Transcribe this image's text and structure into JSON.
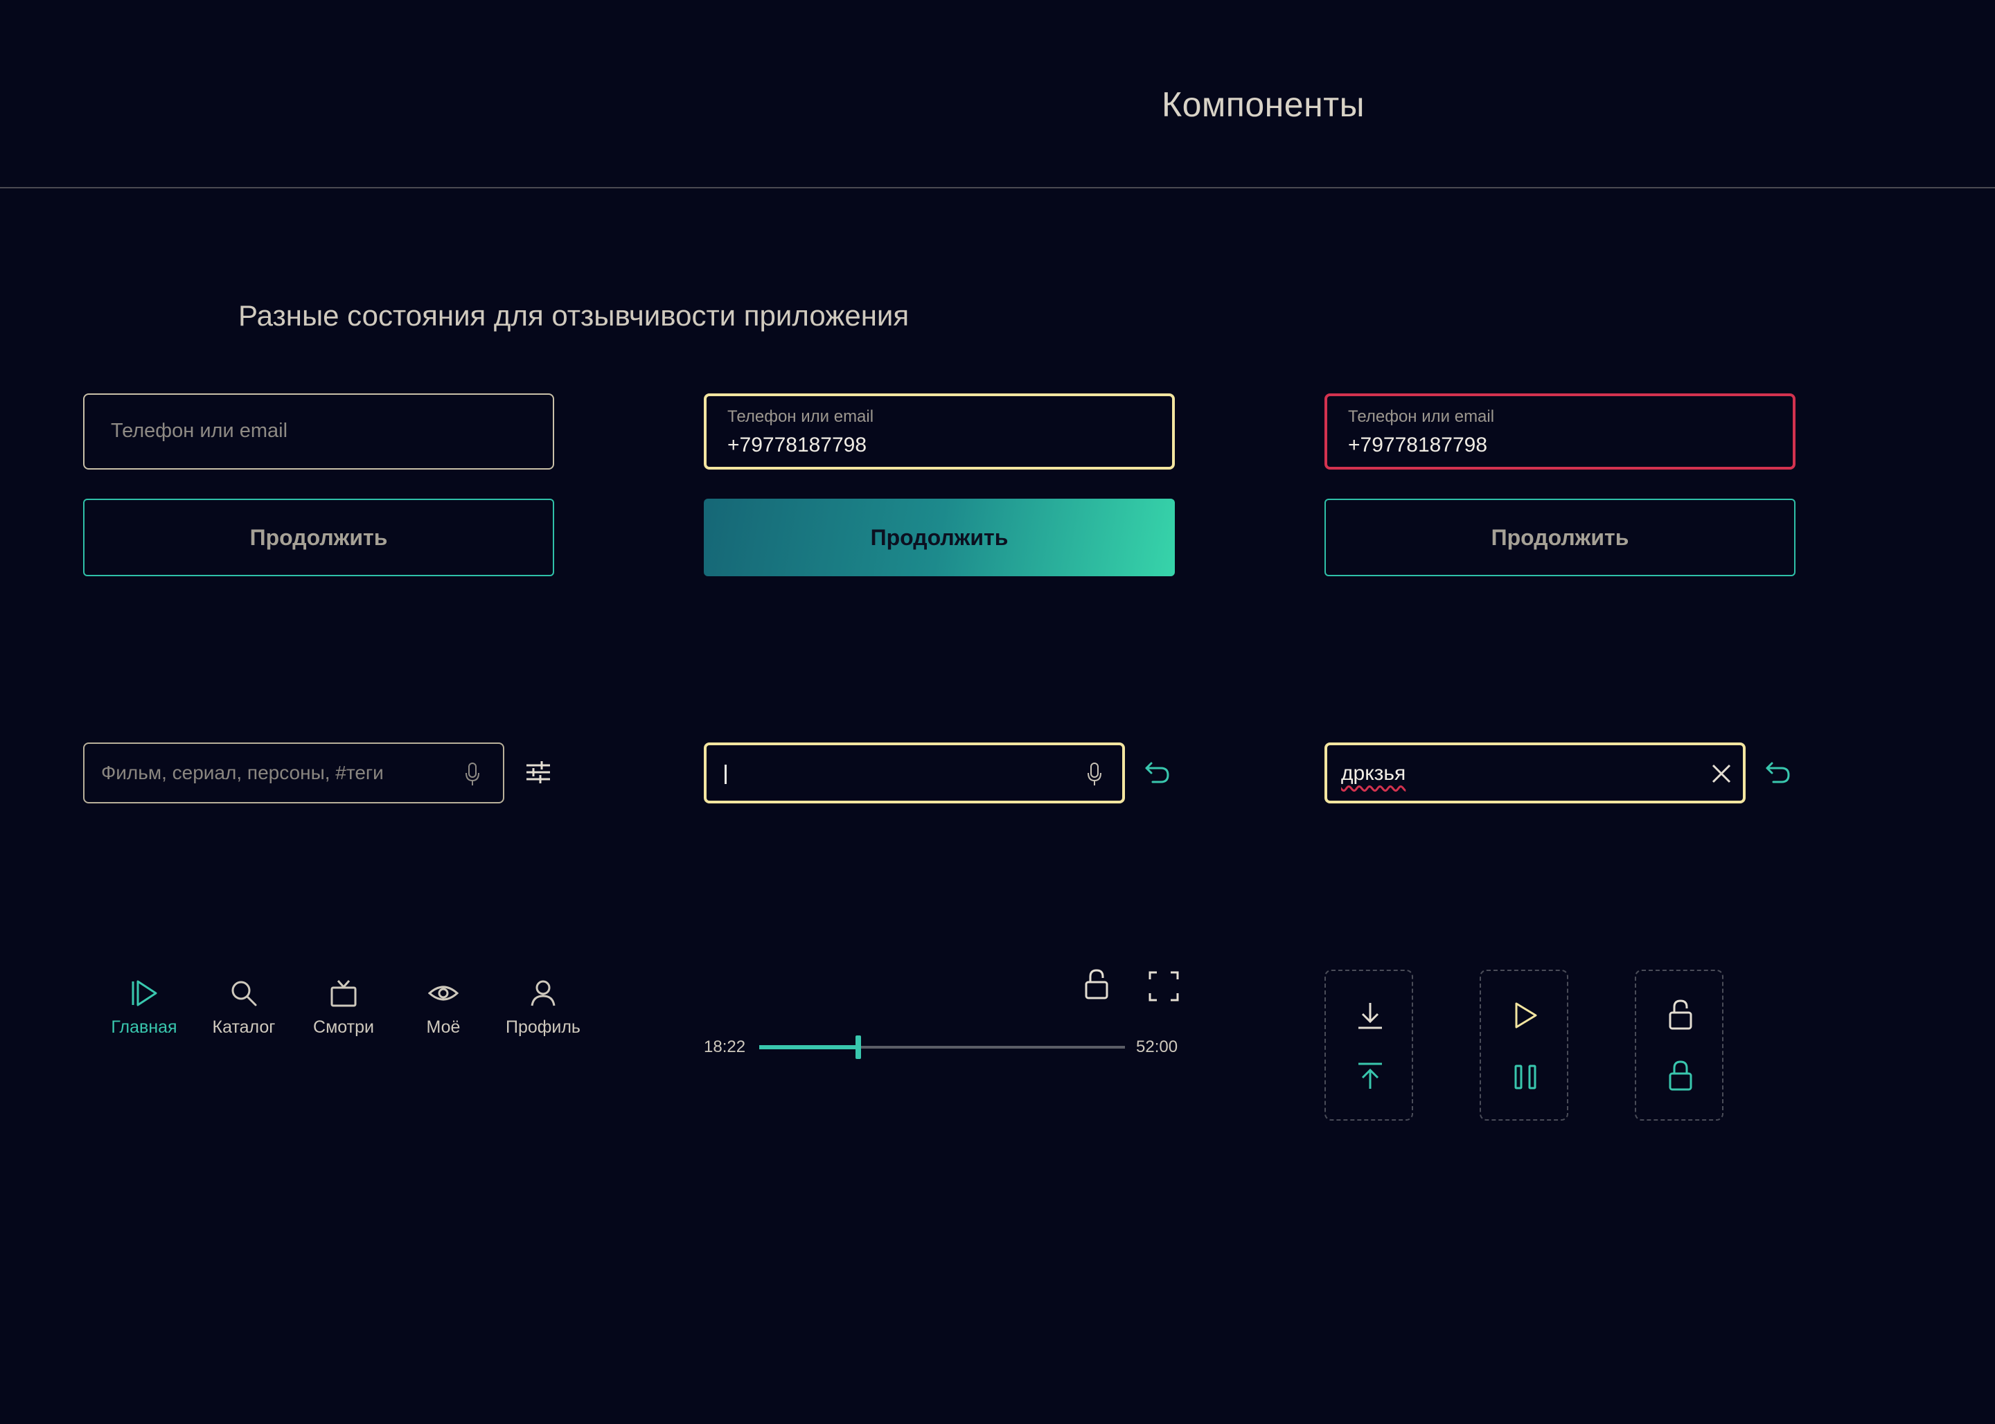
{
  "header": {
    "title": "Компоненты"
  },
  "section": {
    "title": "Разные состояния для отзывчивости приложения"
  },
  "login": {
    "idle": {
      "placeholder": "Телефон или email",
      "button": "Продолжить"
    },
    "focus": {
      "label": "Телефон или email",
      "value": "+79778187798",
      "button": "Продолжить"
    },
    "error": {
      "label": "Телефон или email",
      "value": "+79778187798",
      "button": "Продолжить"
    }
  },
  "search": {
    "idle": {
      "placeholder": "Фильм, сериал, персоны, #теги"
    },
    "typing": {
      "value": "|"
    },
    "filled": {
      "value": "дркзья"
    }
  },
  "nav": {
    "items": [
      {
        "label": "Главная",
        "icon": "play-icon",
        "active": true
      },
      {
        "label": "Каталог",
        "icon": "search-icon",
        "active": false
      },
      {
        "label": "Смотри",
        "icon": "tv-icon",
        "active": false
      },
      {
        "label": "Моё",
        "icon": "eye-icon",
        "active": false
      },
      {
        "label": "Профиль",
        "icon": "user-icon",
        "active": false
      }
    ]
  },
  "player": {
    "current_time": "18:22",
    "total_time": "52:00",
    "progress": 0.27
  },
  "colors": {
    "background": "#05071a",
    "accent": "#39c7ae",
    "focus": "#f3e5a0",
    "error": "#d3324f",
    "text": "#d8d2c6"
  }
}
